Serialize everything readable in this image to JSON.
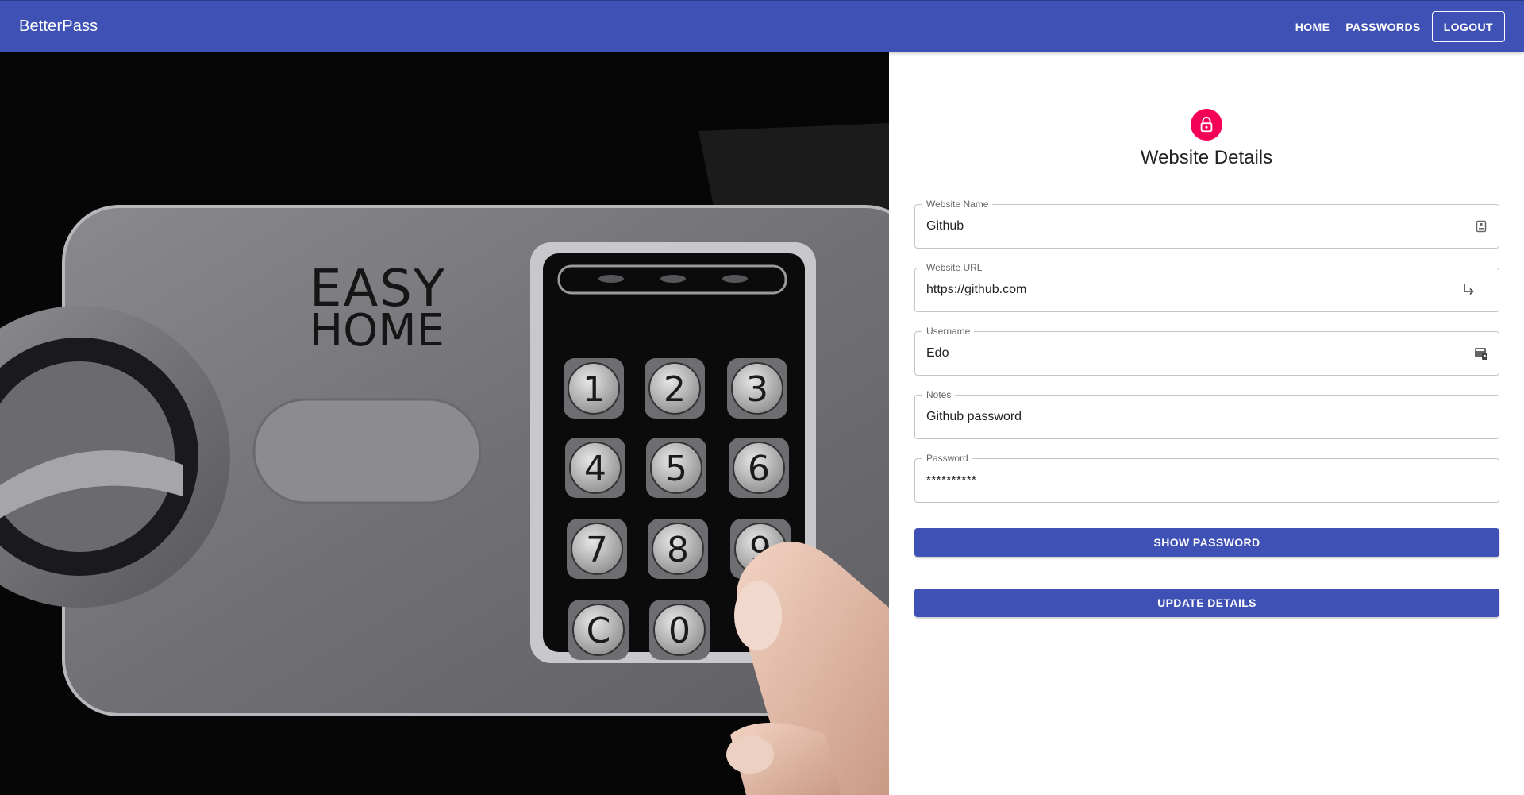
{
  "appbar": {
    "brand": "BetterPass",
    "nav": {
      "home": "HOME",
      "passwords": "PASSWORDS",
      "logout": "LOGOUT"
    },
    "color": "#3f51b5"
  },
  "hero": {
    "logo_line1": "EASY",
    "logo_line2": "HOME",
    "keys": [
      "1",
      "2",
      "3",
      "4",
      "5",
      "6",
      "7",
      "8",
      "9",
      "C",
      "0"
    ]
  },
  "form": {
    "title": "Website Details",
    "avatar_icon": "lock-icon",
    "avatar_color": "#f50057",
    "fields": [
      {
        "label": "Website Name",
        "value": "Github",
        "icon": "badge-icon"
      },
      {
        "label": "Website URL",
        "value": "https://github.com",
        "icon": "subdirectory-arrow-icon"
      },
      {
        "label": "Username",
        "value": "Edo",
        "icon": "contact-card-icon"
      },
      {
        "label": "Notes",
        "value": "Github password",
        "icon": ""
      },
      {
        "label": "Password",
        "value": "**********",
        "icon": ""
      }
    ],
    "show_password_label": "SHOW PASSWORD",
    "update_label": "UPDATE DETAILS"
  }
}
